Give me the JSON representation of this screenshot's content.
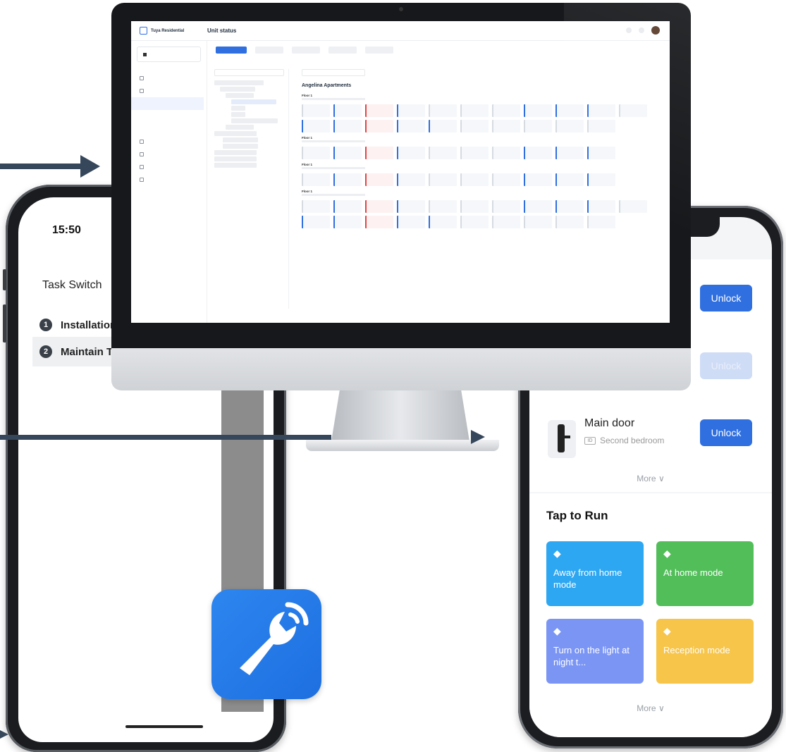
{
  "desktop": {
    "brand": "Tuya Residential",
    "page_title": "Unit status",
    "building": "Angelina Apartments",
    "floor_label": "Floor 1"
  },
  "left_phone": {
    "time": "15:50",
    "title": "Task Switch",
    "close_symbol": "×",
    "tasks": [
      {
        "num": "1",
        "label": "Installation"
      },
      {
        "num": "2",
        "label": "Maintain Ta"
      }
    ]
  },
  "right_phone": {
    "unlock_label": "Unlock",
    "door_name": "Main door",
    "door_room": "Second bedroom",
    "room_badge": "ID",
    "more_label": "More ∨",
    "tap_to_run": "Tap to Run",
    "scenes": [
      {
        "label": "Away from home mode",
        "color": "#2ea7f2"
      },
      {
        "label": "At home mode",
        "color": "#52be5a"
      },
      {
        "label": "Turn on the light at night t...",
        "color": "#7b95f5"
      },
      {
        "label": "Reception mode",
        "color": "#f6c54a"
      }
    ]
  },
  "colors": {
    "accent": "#2f6fe0",
    "arrow": "#36475c",
    "app_icon": "#2a7fee"
  },
  "icons": {
    "app_icon": "wrench-wifi-icon",
    "scene_tag": "tag-icon"
  }
}
